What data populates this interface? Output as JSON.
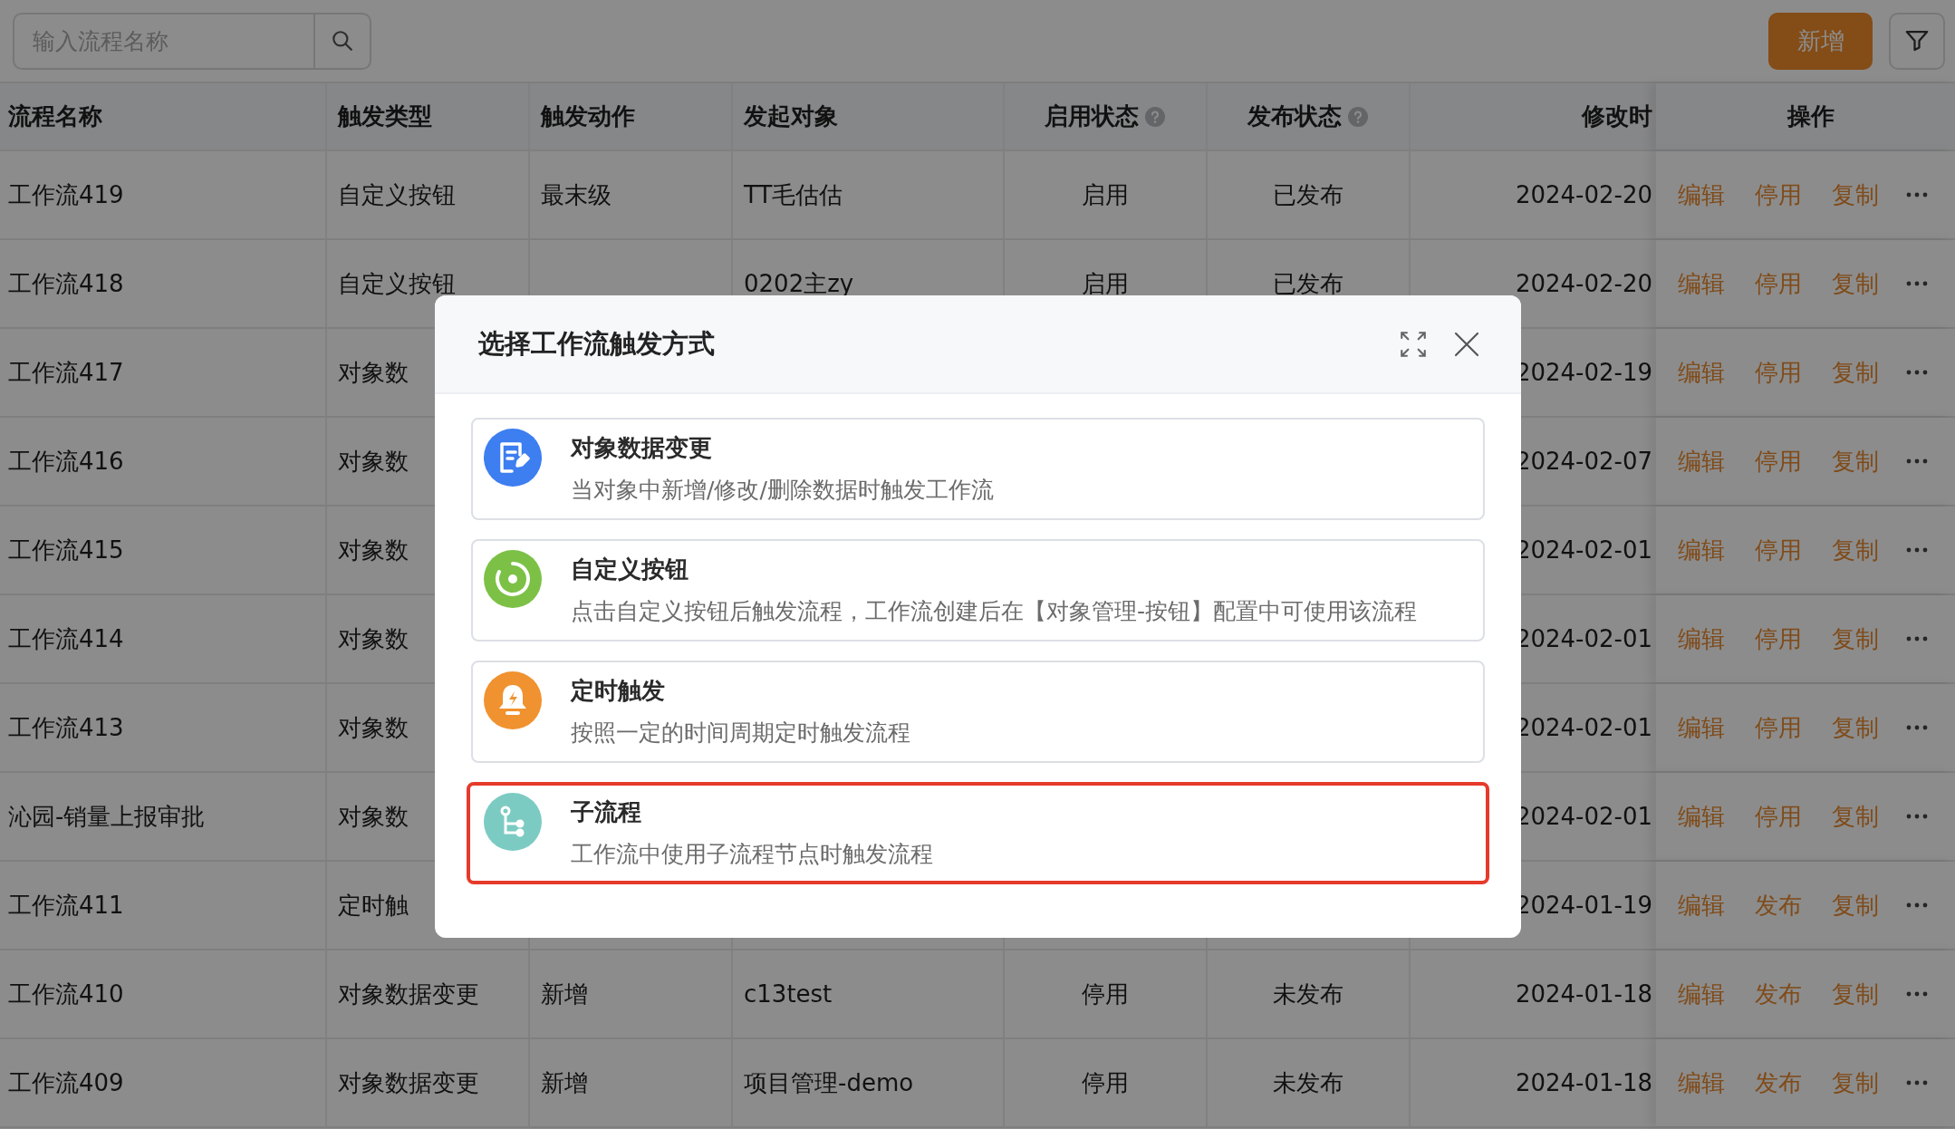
{
  "toolbar": {
    "search": {
      "placeholder": "输入流程名称"
    },
    "add_button": "新增"
  },
  "table": {
    "columns": [
      {
        "label": "流程名称",
        "help": false
      },
      {
        "label": "触发类型",
        "help": false
      },
      {
        "label": "触发动作",
        "help": false
      },
      {
        "label": "发起对象",
        "help": false
      },
      {
        "label": "启用状态",
        "help": true
      },
      {
        "label": "发布状态",
        "help": true
      },
      {
        "label": "修改时",
        "help": false
      },
      {
        "label": "操作",
        "help": false
      }
    ],
    "rows": [
      {
        "cells": [
          "工作流419",
          "自定义按钮",
          "最末级",
          "TT毛估估",
          "启用",
          "已发布",
          "2024-02-20"
        ],
        "actions": [
          "编辑",
          "停用",
          "复制"
        ]
      },
      {
        "cells": [
          "工作流418",
          "自定义按钮",
          null,
          "0202主zy",
          "启用",
          "已发布",
          "2024-02-20"
        ],
        "actions": [
          "编辑",
          "停用",
          "复制"
        ]
      },
      {
        "cells": [
          "工作流417",
          "对象数",
          null,
          null,
          null,
          null,
          "2024-02-19"
        ],
        "actions": [
          "编辑",
          "停用",
          "复制"
        ]
      },
      {
        "cells": [
          "工作流416",
          "对象数",
          null,
          null,
          null,
          null,
          "2024-02-07"
        ],
        "actions": [
          "编辑",
          "停用",
          "复制"
        ]
      },
      {
        "cells": [
          "工作流415",
          "对象数",
          null,
          null,
          null,
          null,
          "2024-02-01"
        ],
        "actions": [
          "编辑",
          "停用",
          "复制"
        ]
      },
      {
        "cells": [
          "工作流414",
          "对象数",
          null,
          null,
          null,
          null,
          "2024-02-01"
        ],
        "actions": [
          "编辑",
          "停用",
          "复制"
        ]
      },
      {
        "cells": [
          "工作流413",
          "对象数",
          null,
          null,
          null,
          null,
          "2024-02-01"
        ],
        "actions": [
          "编辑",
          "停用",
          "复制"
        ]
      },
      {
        "cells": [
          "沁园-销量上报审批",
          "对象数",
          null,
          null,
          null,
          null,
          "2024-02-01"
        ],
        "actions": [
          "编辑",
          "停用",
          "复制"
        ]
      },
      {
        "cells": [
          "工作流411",
          "定时触",
          null,
          null,
          null,
          null,
          "2024-01-19"
        ],
        "actions": [
          "编辑",
          "发布",
          "复制"
        ]
      },
      {
        "cells": [
          "工作流410",
          "对象数据变更",
          "新增",
          "c13test",
          "停用",
          "未发布",
          "2024-01-18"
        ],
        "actions": [
          "编辑",
          "发布",
          "复制"
        ]
      },
      {
        "cells": [
          "工作流409",
          "对象数据变更",
          "新增",
          "项目管理-demo",
          "停用",
          "未发布",
          "2024-01-18"
        ],
        "actions": [
          "编辑",
          "发布",
          "复制"
        ]
      }
    ]
  },
  "dialog": {
    "title": "选择工作流触发方式",
    "options": [
      {
        "kind": "data",
        "color": "#3d7ef0",
        "title": "对象数据变更",
        "description": "当对象中新增/修改/删除数据时触发工作流",
        "selected": false
      },
      {
        "kind": "button",
        "color": "#7cc146",
        "title": "自定义按钮",
        "description": "点击自定义按钮后触发流程，工作流创建后在【对象管理-按钮】配置中可使用该流程",
        "selected": false
      },
      {
        "kind": "timer",
        "color": "#f0922f",
        "title": "定时触发",
        "description": "按照一定的时间周期定时触发流程",
        "selected": false
      },
      {
        "kind": "subflow",
        "color": "#7ccbc3",
        "title": "子流程",
        "description": "工作流中使用子流程节点时触发流程",
        "selected": true
      }
    ]
  }
}
